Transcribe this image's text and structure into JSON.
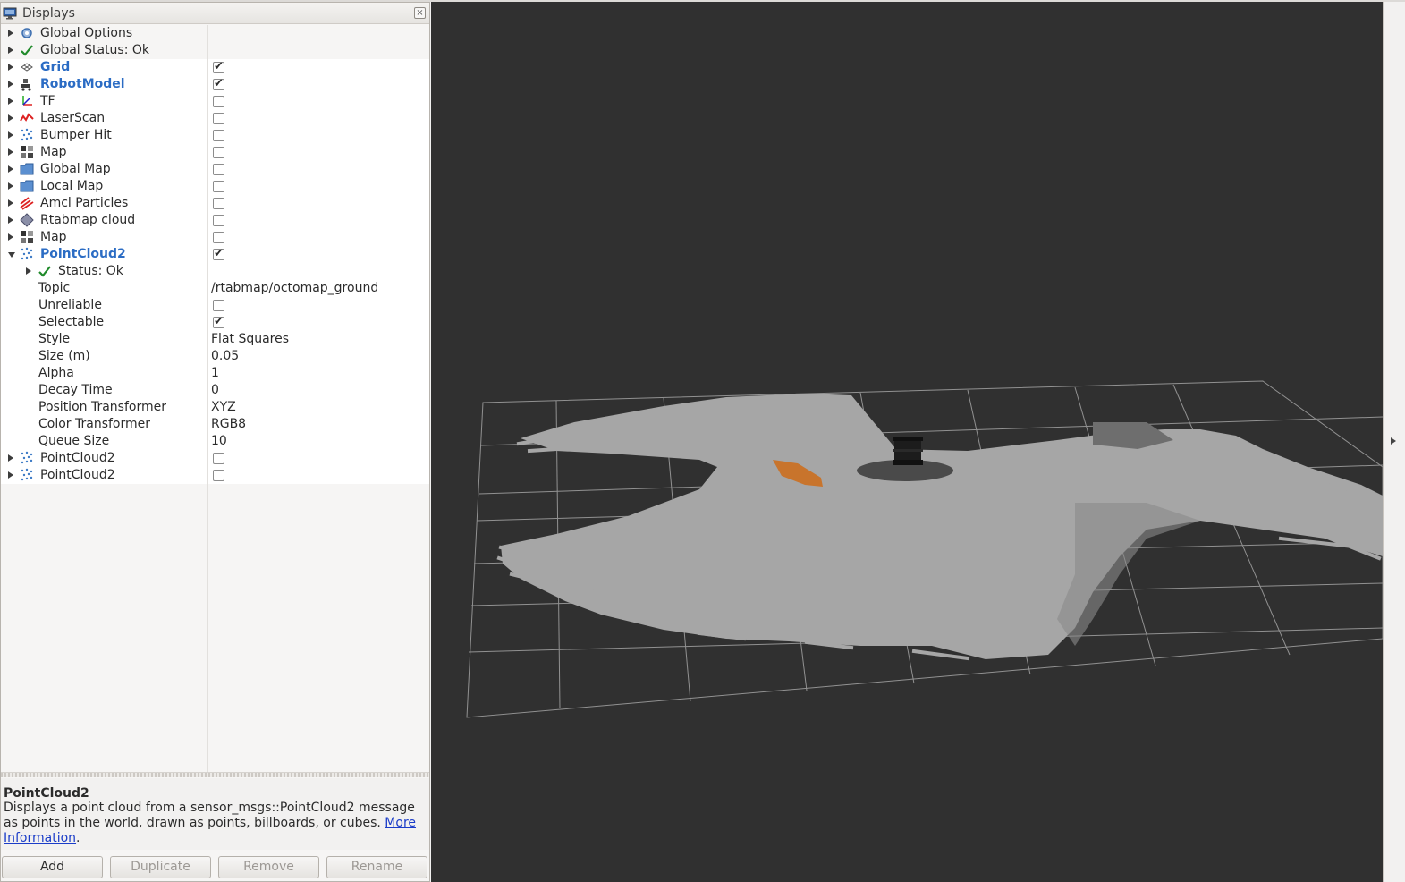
{
  "panel": {
    "title": "Displays",
    "close_label": "×"
  },
  "tree": {
    "rows": [
      {
        "label": "Global Options",
        "icon": "gear-icon",
        "expand": "right",
        "indent": 0,
        "style": "normal",
        "check": null,
        "value": ""
      },
      {
        "label": "Global Status: Ok",
        "icon": "check-icon",
        "expand": "right",
        "indent": 0,
        "style": "normal",
        "check": null,
        "value": ""
      },
      {
        "label": "Grid",
        "icon": "grid-icon",
        "expand": "right",
        "indent": 0,
        "style": "bold-blue",
        "check": true,
        "value": ""
      },
      {
        "label": "RobotModel",
        "icon": "robot-icon",
        "expand": "right",
        "indent": 0,
        "style": "bold-blue",
        "check": true,
        "value": ""
      },
      {
        "label": "TF",
        "icon": "tf-axes-icon",
        "expand": "right",
        "indent": 0,
        "style": "normal",
        "check": false,
        "value": ""
      },
      {
        "label": "LaserScan",
        "icon": "laserscan-icon",
        "expand": "right",
        "indent": 0,
        "style": "normal",
        "check": false,
        "value": ""
      },
      {
        "label": "Bumper Hit",
        "icon": "pointcloud-icon",
        "expand": "right",
        "indent": 0,
        "style": "normal",
        "check": false,
        "value": ""
      },
      {
        "label": "Map",
        "icon": "map-icon",
        "expand": "right",
        "indent": 0,
        "style": "normal",
        "check": false,
        "value": ""
      },
      {
        "label": "Global Map",
        "icon": "folder-icon",
        "expand": "right",
        "indent": 0,
        "style": "normal",
        "check": false,
        "value": ""
      },
      {
        "label": "Local Map",
        "icon": "folder-icon",
        "expand": "right",
        "indent": 0,
        "style": "normal",
        "check": false,
        "value": ""
      },
      {
        "label": "Amcl Particles",
        "icon": "posearray-icon",
        "expand": "right",
        "indent": 0,
        "style": "normal",
        "check": false,
        "value": ""
      },
      {
        "label": "Rtabmap cloud",
        "icon": "diamond-icon",
        "expand": "right",
        "indent": 0,
        "style": "normal",
        "check": false,
        "value": ""
      },
      {
        "label": "Map",
        "icon": "map-icon",
        "expand": "right",
        "indent": 0,
        "style": "normal",
        "check": false,
        "value": ""
      },
      {
        "label": "PointCloud2",
        "icon": "pointcloud-icon",
        "expand": "down",
        "indent": 0,
        "style": "bold-blue",
        "check": true,
        "value": ""
      },
      {
        "label": "Status: Ok",
        "icon": "check-icon",
        "expand": "right",
        "indent": 1,
        "style": "normal",
        "check": null,
        "value": ""
      },
      {
        "label": "Topic",
        "icon": "",
        "expand": "",
        "indent": 2,
        "style": "normal",
        "check": null,
        "value": "/rtabmap/octomap_ground"
      },
      {
        "label": "Unreliable",
        "icon": "",
        "expand": "",
        "indent": 2,
        "style": "normal",
        "check": false,
        "value": ""
      },
      {
        "label": "Selectable",
        "icon": "",
        "expand": "",
        "indent": 2,
        "style": "normal",
        "check": true,
        "value": ""
      },
      {
        "label": "Style",
        "icon": "",
        "expand": "",
        "indent": 2,
        "style": "normal",
        "check": null,
        "value": "Flat Squares"
      },
      {
        "label": "Size (m)",
        "icon": "",
        "expand": "",
        "indent": 2,
        "style": "normal",
        "check": null,
        "value": "0.05"
      },
      {
        "label": "Alpha",
        "icon": "",
        "expand": "",
        "indent": 2,
        "style": "normal",
        "check": null,
        "value": "1"
      },
      {
        "label": "Decay Time",
        "icon": "",
        "expand": "",
        "indent": 2,
        "style": "normal",
        "check": null,
        "value": "0"
      },
      {
        "label": "Position Transformer",
        "icon": "",
        "expand": "",
        "indent": 2,
        "style": "normal",
        "check": null,
        "value": "XYZ"
      },
      {
        "label": "Color Transformer",
        "icon": "",
        "expand": "",
        "indent": 2,
        "style": "normal",
        "check": null,
        "value": "RGB8"
      },
      {
        "label": "Queue Size",
        "icon": "",
        "expand": "",
        "indent": 2,
        "style": "normal",
        "check": null,
        "value": "10"
      },
      {
        "label": "PointCloud2",
        "icon": "pointcloud-icon",
        "expand": "right",
        "indent": 0,
        "style": "normal",
        "check": false,
        "value": ""
      },
      {
        "label": "PointCloud2",
        "icon": "pointcloud-icon",
        "expand": "right",
        "indent": 0,
        "style": "normal",
        "check": false,
        "value": ""
      }
    ]
  },
  "help": {
    "title": "PointCloud2",
    "text": "Displays a point cloud from a sensor_msgs::PointCloud2 message as points in the world, drawn as points, billboards, or cubes. ",
    "link_text": "More Information",
    "period": "."
  },
  "buttons": {
    "add": "Add",
    "duplicate": "Duplicate",
    "remove": "Remove",
    "rename": "Rename"
  },
  "colors": {
    "viewport_bg": "#303030",
    "grid_line": "#a0a0a0",
    "cloud": "#a6a6a6",
    "cloud_shadow": "#6e6e6e",
    "accent_orange": "#c8742c",
    "link_blue": "#1a3cc8",
    "highlight_blue": "#2b6cc4"
  }
}
